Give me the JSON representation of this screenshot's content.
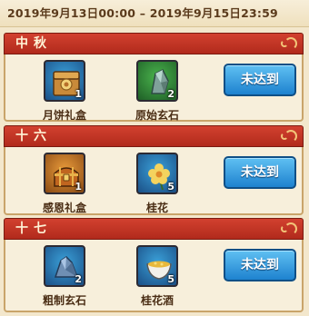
{
  "event": {
    "date_range": "2019年9月13日00:00 – 2019年9月15日23:59"
  },
  "sections": [
    {
      "title": "中秋",
      "items": [
        {
          "name": "月饼礼盒",
          "count": "1",
          "icon": "mooncake-gift-box-icon",
          "rarity_color": "#1b4f86"
        },
        {
          "name": "原始玄石",
          "count": "2",
          "icon": "raw-crystal-icon",
          "rarity_color": "#1f5f27"
        }
      ],
      "button": "未达到"
    },
    {
      "title": "十六",
      "items": [
        {
          "name": "感恩礼盒",
          "count": "1",
          "icon": "treasure-chest-icon",
          "rarity_color": "#8a4a14"
        },
        {
          "name": "桂花",
          "count": "5",
          "icon": "osmanthus-flower-icon",
          "rarity_color": "#1b4f86"
        }
      ],
      "button": "未达到"
    },
    {
      "title": "十七",
      "items": [
        {
          "name": "粗制玄石",
          "count": "2",
          "icon": "rough-crystal-icon",
          "rarity_color": "#1b4f86"
        },
        {
          "name": "桂花酒",
          "count": "5",
          "icon": "osmanthus-wine-icon",
          "rarity_color": "#1b4f86"
        }
      ],
      "button": "未达到"
    }
  ]
}
